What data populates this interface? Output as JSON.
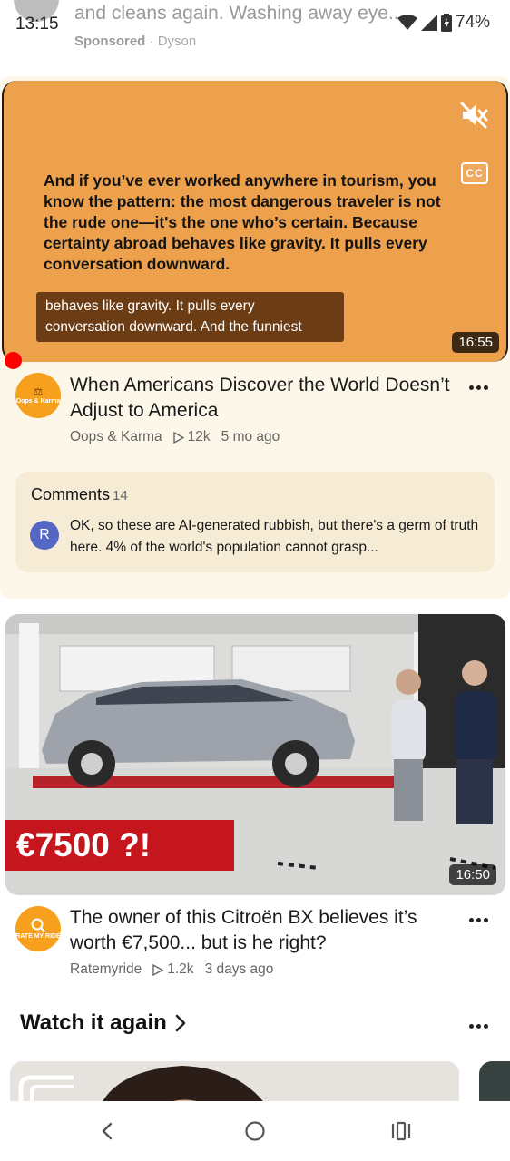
{
  "status_bar": {
    "time": "13:15",
    "battery": "74%"
  },
  "ad_peek": {
    "text": "and cleans again. Washing away eye...",
    "sponsored": "Sponsored",
    "separator": "·",
    "advertiser": "Dyson"
  },
  "video1": {
    "slide_text": "And if you’ve ever worked anywhere in tourism, you know the pattern: the most dangerous traveler is not the rude one—it's the one who’s certain. Because certainty abroad behaves like gravity. It pulls every conversation downward.",
    "caption": "behaves like gravity. It pulls every conversation downward. And the funniest",
    "cc_label": "CC",
    "duration": "16:55",
    "progress_fraction": 0.02,
    "title": "When Americans Discover the World Doesn’t Adjust to America",
    "channel": "Oops & Karma",
    "channel_avatar_text": "Oops & Karma",
    "views": "12k",
    "age": "5 mo ago",
    "icons": {
      "mute": "mute-icon",
      "more": "more-icon",
      "views": "play-icon"
    }
  },
  "comments": {
    "label": "Comments",
    "count": "14",
    "first_initial": "R",
    "first_text": "OK, so these are AI-generated rubbish, but there's a germ of truth here.  4% of the world's population cannot grasp..."
  },
  "video2": {
    "price_overlay": "€7500 ?!",
    "duration": "16:50",
    "title": "The owner of this Citroën BX believes it’s worth €7,500... but is he right?",
    "channel": "Ratemyride",
    "channel_avatar_text": "RATE MY RIDE",
    "views": "1.2k",
    "age": "3 days ago"
  },
  "watch_again": {
    "title": "Watch it again"
  },
  "colors": {
    "accent_red": "#ff0000",
    "card_bg": "#fdf7ea",
    "video1_bg": "#eea14d",
    "price_red": "#c4161c"
  },
  "nav": {
    "icons": [
      "back-icon",
      "home-icon",
      "recents-icon"
    ]
  }
}
